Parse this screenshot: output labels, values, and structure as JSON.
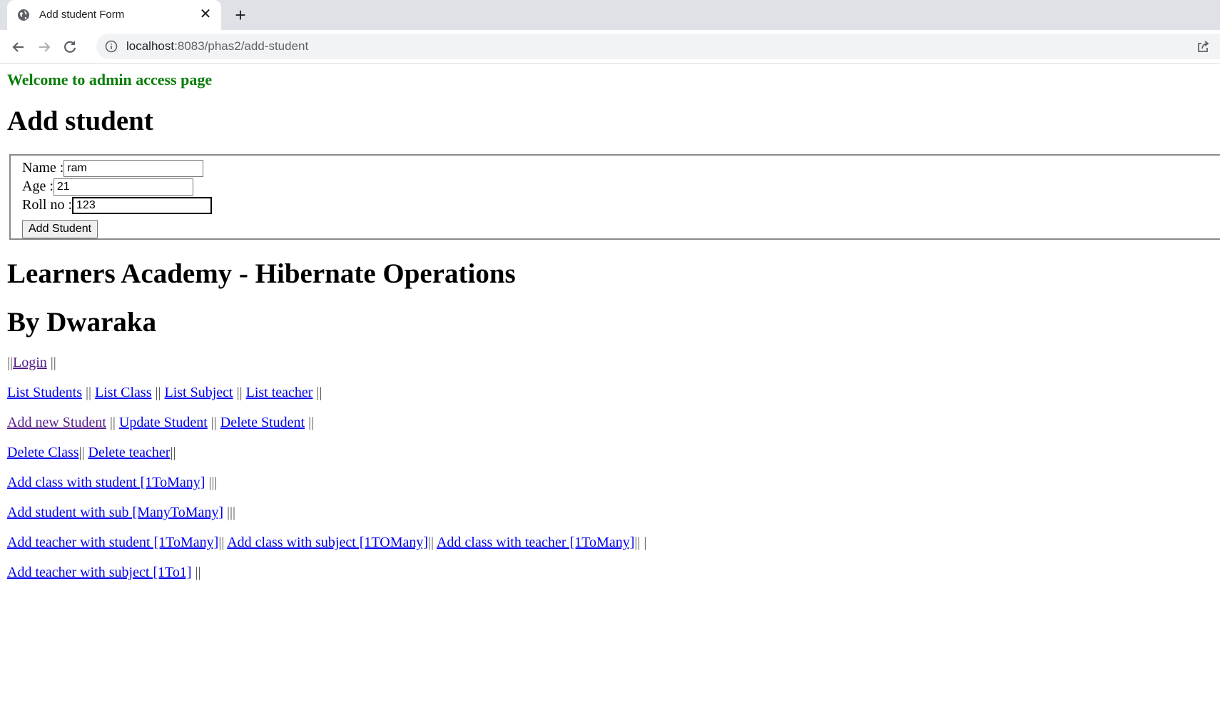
{
  "browser": {
    "tab_title": "Add student Form",
    "url_host": "localhost",
    "url_rest": ":8083/phas2/add-student"
  },
  "page": {
    "welcome": "Welcome to admin access page",
    "heading": "Add student",
    "title1": "Learners Academy - Hibernate Operations",
    "title2": "By Dwaraka"
  },
  "form": {
    "name_label": "Name :",
    "name_value": "ram",
    "age_label": "Age :",
    "age_value": "21",
    "roll_label": "Roll no :",
    "roll_value": "123",
    "submit_label": "Add Student"
  },
  "nav": {
    "sep": "||",
    "sep3": "|||",
    "sep_end": "|| |",
    "login": "Login",
    "list_students": "List Students",
    "list_class": "List Class",
    "list_subject": "List Subject",
    "list_teacher": "List teacher",
    "add_student": "Add new Student",
    "update_student": "Update Student",
    "delete_student": "Delete Student",
    "delete_class": "Delete Class",
    "delete_teacher": "Delete teacher",
    "class_student": "Add class with student [1ToMany]",
    "student_sub": "Add student with sub [ManyToMany]",
    "teacher_student": "Add teacher with student [1ToMany]",
    "class_subject": "Add class with subject [1TOMany]",
    "class_teacher": "Add class with teacher [1ToMany]",
    "teacher_subject": "Add teacher with subject [1To1]"
  }
}
